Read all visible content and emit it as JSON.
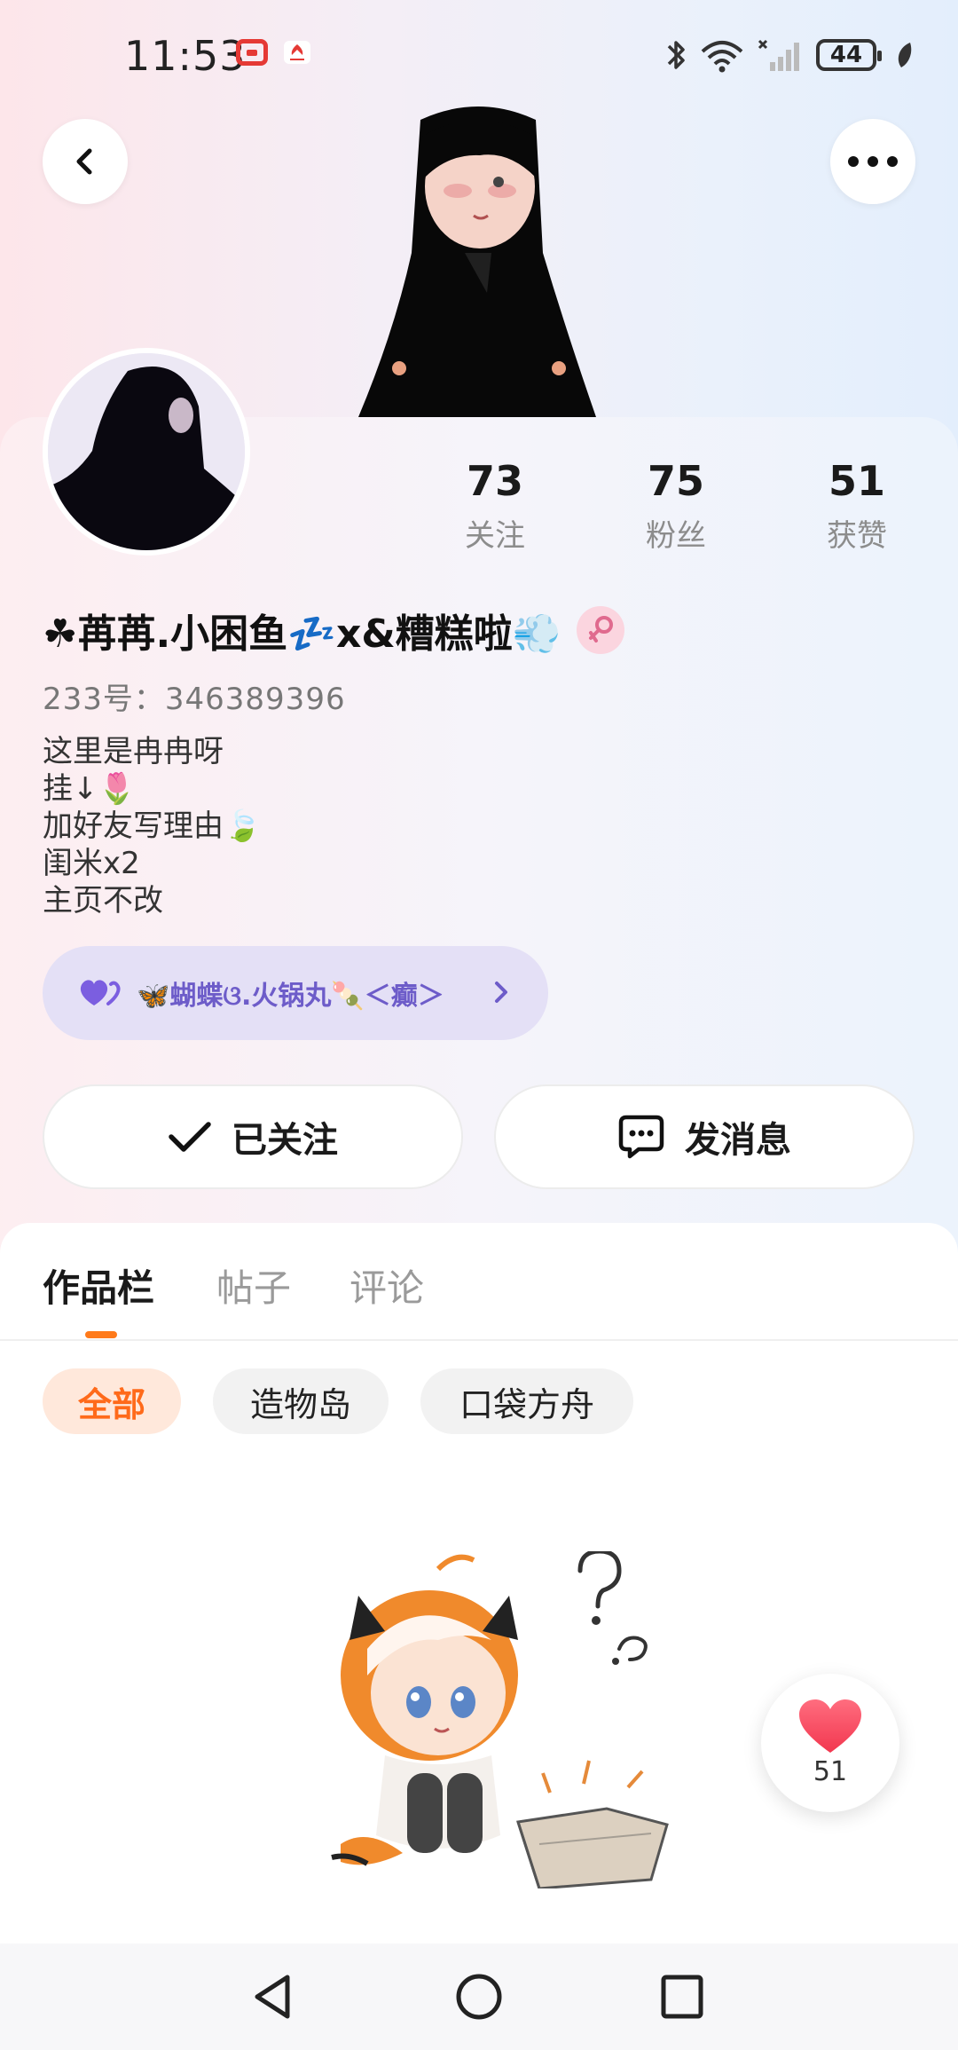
{
  "status_bar": {
    "time": "11:53",
    "battery": "44",
    "icons": [
      "app-notification-icon",
      "huawei-icon",
      "bluetooth-icon",
      "wifi-icon",
      "signal-icon",
      "battery-icon",
      "leaf-icon"
    ]
  },
  "header": {
    "back_icon": "chevron-left-icon",
    "more_icon": "more-dots-icon"
  },
  "profile": {
    "stats": [
      {
        "value": "73",
        "label": "关注"
      },
      {
        "value": "75",
        "label": "粉丝"
      },
      {
        "value": "51",
        "label": "获赞"
      }
    ],
    "nickname": "☘苒苒.小困鱼💤x&糟糕啦💨",
    "gender_icon": "female-icon",
    "uid": "233号：346389396",
    "bio_lines": [
      "这里是冉冉呀",
      "挂↓🌷",
      "加好友写理由🍃",
      "闺米x2",
      "主页不改"
    ],
    "fan_group": "🦋蝴蝶ଓ.火锅丸🍡＜癫＞",
    "follow_label": "已关注",
    "message_label": "发消息"
  },
  "tabs": [
    {
      "label": "作品栏",
      "active": true
    },
    {
      "label": "帖子",
      "active": false
    },
    {
      "label": "评论",
      "active": false
    }
  ],
  "filters": [
    {
      "label": "全部",
      "active": true
    },
    {
      "label": "造物岛",
      "active": false
    },
    {
      "label": "口袋方舟",
      "active": false
    }
  ],
  "like_float": {
    "count": "51"
  },
  "colors": {
    "accent": "#ff6a1a",
    "purple": "#6d5cc9",
    "heart": "#f2374f"
  }
}
